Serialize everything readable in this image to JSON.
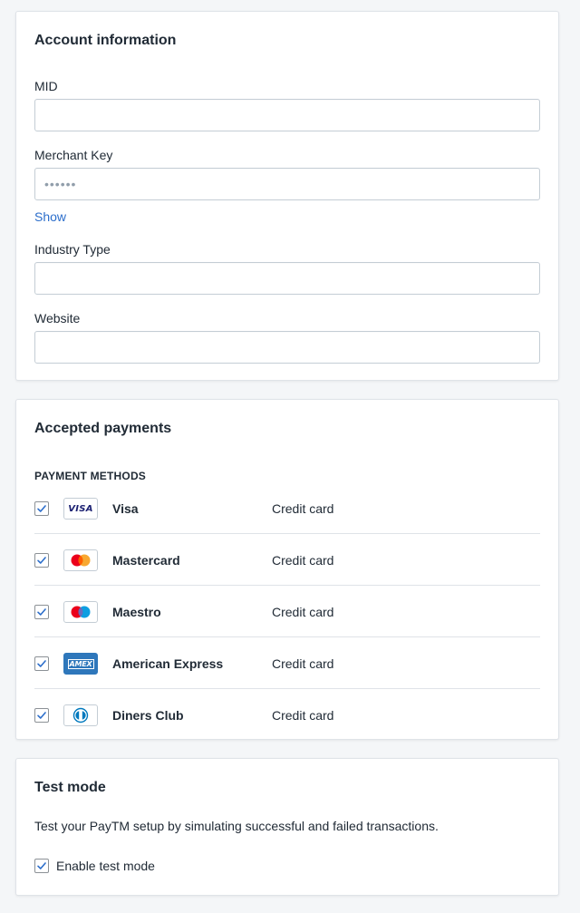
{
  "account": {
    "title": "Account information",
    "mid_label": "MID",
    "mid_value": "",
    "merchant_key_label": "Merchant Key",
    "merchant_key_placeholder": "••••••",
    "show_link": "Show",
    "industry_label": "Industry Type",
    "industry_value": "",
    "website_label": "Website",
    "website_value": ""
  },
  "payments": {
    "title": "Accepted payments",
    "caption": "Payment methods",
    "methods": [
      {
        "name": "Visa",
        "type": "Credit card",
        "icon": "visa-logo",
        "checked": true
      },
      {
        "name": "Mastercard",
        "type": "Credit card",
        "icon": "mastercard-logo",
        "checked": true
      },
      {
        "name": "Maestro",
        "type": "Credit card",
        "icon": "maestro-logo",
        "checked": true
      },
      {
        "name": "American Express",
        "type": "Credit card",
        "icon": "amex-logo",
        "checked": true
      },
      {
        "name": "Diners Club",
        "type": "Credit card",
        "icon": "diners-club-logo",
        "checked": true
      }
    ],
    "visa_logo_text": "VISA",
    "amex_logo_text": "AMEX"
  },
  "test_mode": {
    "title": "Test mode",
    "description": "Test your PayTM setup by simulating successful and failed transactions.",
    "enable_label": "Enable test mode",
    "enabled": true
  },
  "colors": {
    "link": "#2c6ecb",
    "checkbox_check": "#2c6ecb",
    "amex_blue": "#2e77bb",
    "visa_blue": "#1a1f71",
    "mastercard_red": "#eb001b",
    "mastercard_orange": "#f79e1b",
    "maestro_blue": "#0099df"
  }
}
